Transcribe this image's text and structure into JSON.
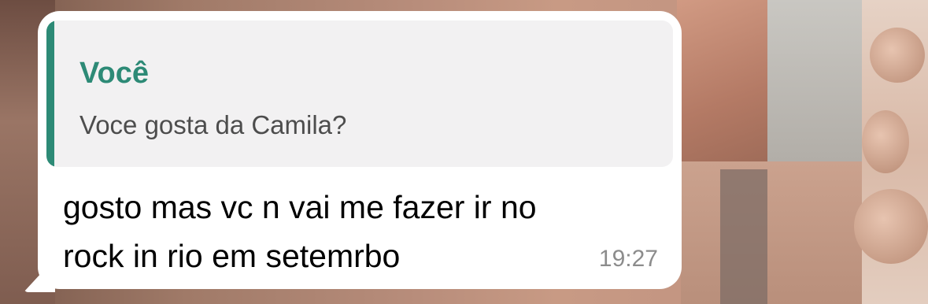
{
  "message": {
    "quoted": {
      "author": "Você",
      "text": "Voce gosta da Camila?"
    },
    "lines": [
      "gosto mas vc n vai me fazer ir no",
      "rock in rio em setemrbo"
    ],
    "time": "19:27"
  },
  "colors": {
    "quote_accent": "#2d8a76",
    "bubble": "#ffffff",
    "quote_background": "#f2f1f2"
  }
}
